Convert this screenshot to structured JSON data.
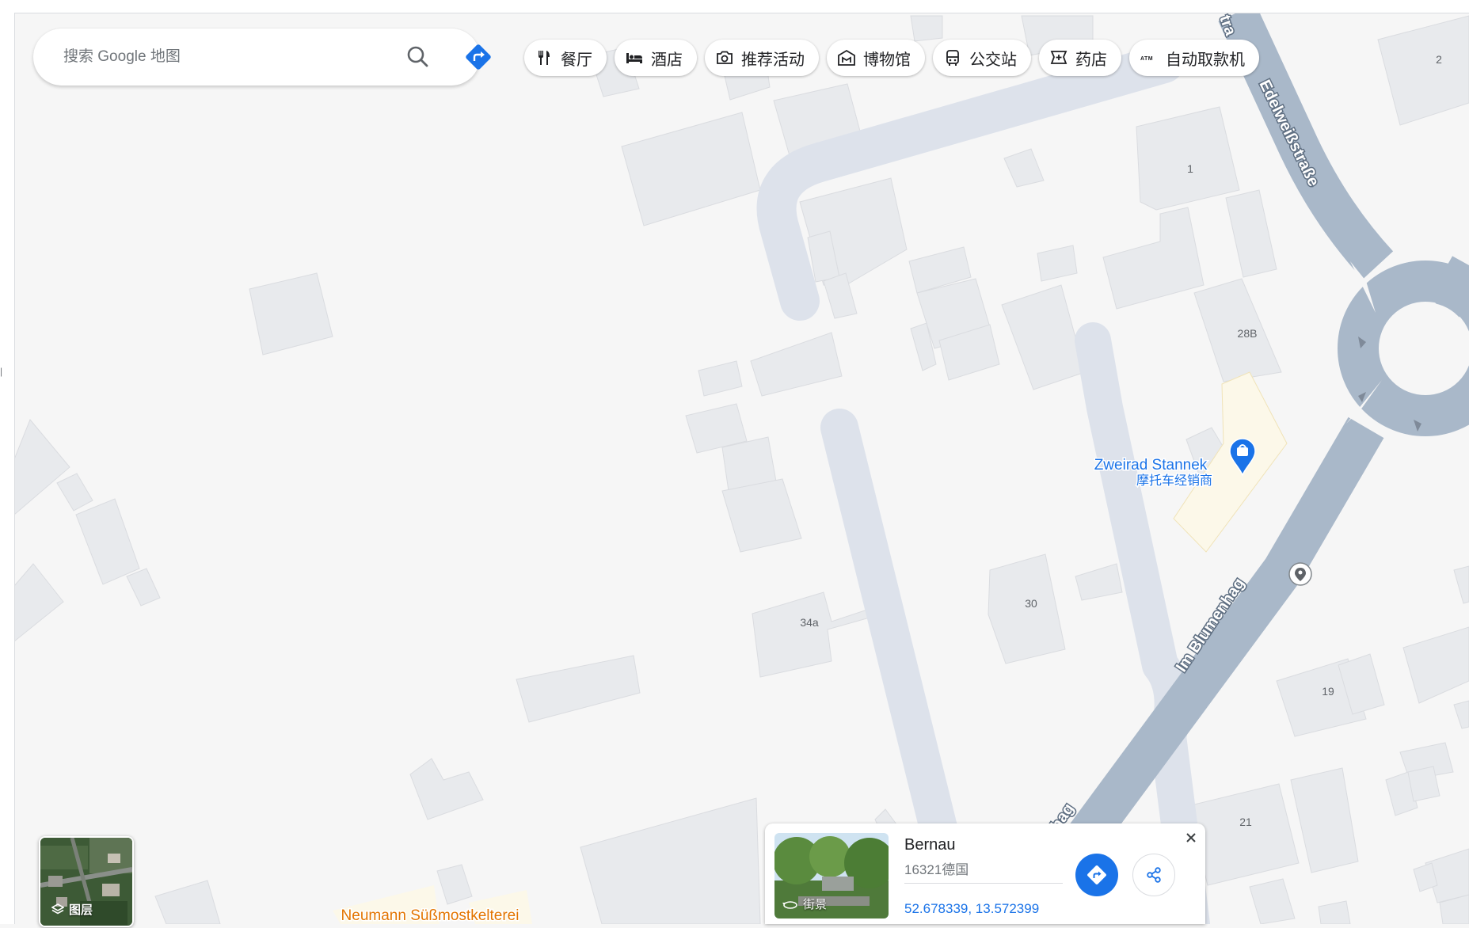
{
  "search": {
    "placeholder": "搜索 Google 地图",
    "search_icon": "search-icon",
    "directions_icon": "directions-icon"
  },
  "chips": [
    {
      "icon": "restaurant-icon",
      "label": "餐厅"
    },
    {
      "icon": "hotel-icon",
      "label": "酒店"
    },
    {
      "icon": "camera-icon",
      "label": "推荐活动"
    },
    {
      "icon": "museum-icon",
      "label": "博物馆"
    },
    {
      "icon": "bus-icon",
      "label": "公交站"
    },
    {
      "icon": "pharmacy-icon",
      "label": "药店"
    },
    {
      "icon": "atm-icon",
      "label": "自动取款机"
    }
  ],
  "map": {
    "streets": [
      "Edelweißstraße",
      "Im Blumenhag",
      "Im Blumenhag"
    ],
    "street_fragments": {
      "top": "tra",
      "bottom": "nhag"
    },
    "house_numbers": [
      "2",
      "1",
      "28B",
      "30",
      "34a",
      "19",
      "21"
    ],
    "pois": [
      {
        "name": "Zweirad Stannek",
        "category": "摩托车经销商",
        "icon": "shopping-bag-icon"
      },
      {
        "name": "Neumann Süßmostkelterei",
        "category": "",
        "icon": "shopping-bag-icon"
      }
    ],
    "colors": {
      "background": "#f6f6f6",
      "building": "#e8eaed",
      "building_outline": "#dadce0",
      "road": "#dde2eb",
      "main_road": "#a9b8c9",
      "poi_blue": "#1a73e8",
      "poi_orange": "#e37400",
      "poi_area": "#fcf8e9"
    }
  },
  "layers": {
    "label": "图层",
    "icon": "layers-icon"
  },
  "place_card": {
    "name": "Bernau",
    "address": "16321德国",
    "coordinates": "52.678339, 13.572399",
    "street_view_label": "街景",
    "directions_icon": "directions-icon",
    "share_icon": "share-icon",
    "close_icon": "close-icon"
  }
}
